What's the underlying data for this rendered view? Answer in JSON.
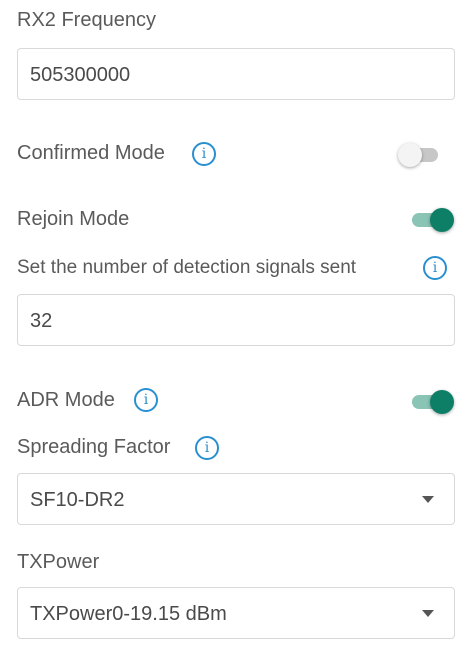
{
  "rx2_frequency": {
    "label": "RX2 Frequency",
    "value": "505300000"
  },
  "confirmed_mode": {
    "label": "Confirmed Mode",
    "info_icon": "ⓘ",
    "enabled": false
  },
  "rejoin_mode": {
    "label": "Rejoin Mode",
    "enabled": true
  },
  "detection_signals": {
    "label": "Set the number of detection signals  sent",
    "info_icon": "ⓘ",
    "value": "32"
  },
  "adr_mode": {
    "label": "ADR Mode",
    "info_icon": "ⓘ",
    "enabled": true
  },
  "spreading_factor": {
    "label": "Spreading Factor",
    "info_icon": "ⓘ",
    "selected": "SF10-DR2"
  },
  "tx_power": {
    "label": "TXPower",
    "selected": "TXPower0-19.15 dBm"
  },
  "colors": {
    "accent": "#0e7f67",
    "info": "#2a8fd0",
    "toggle_off": "#c7c7c7",
    "border": "#d9d9d9"
  },
  "icons": {
    "info": "info-icon",
    "dropdown": "chevron-down-icon"
  }
}
